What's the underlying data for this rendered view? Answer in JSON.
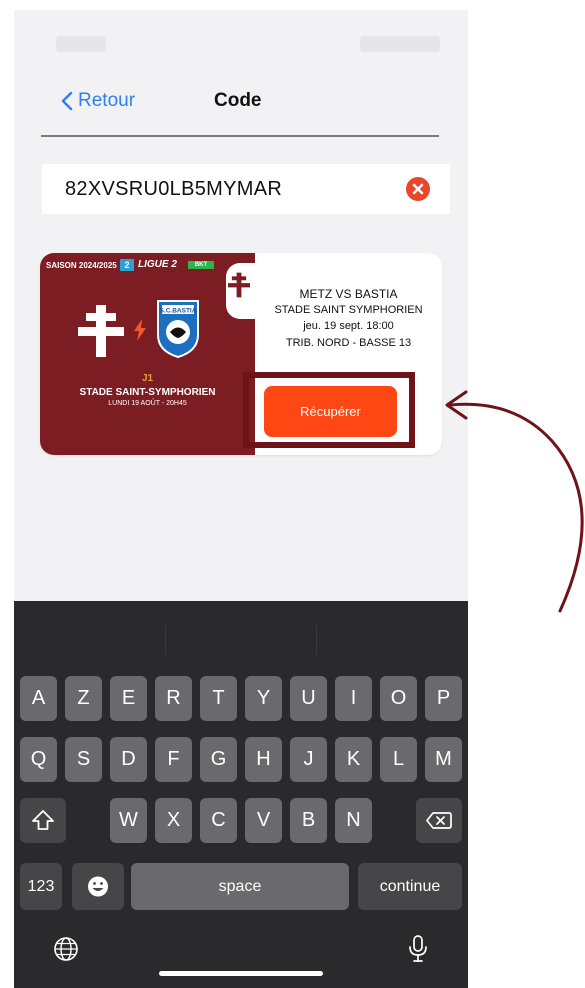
{
  "nav": {
    "back_label": "Retour",
    "title": "Code"
  },
  "code_input": {
    "value": "82XVSRU0LB5MYMAR"
  },
  "ticket": {
    "season": "SAISON 2024/2025",
    "league_badge": "2",
    "league": "LIGUE 2",
    "sponsor": "BKT",
    "away_crest_text": "S.C.BASTIA",
    "matchday": "J1",
    "stadium_left": "STADE SAINT-SYMPHORIEN",
    "date_left": "LUNDI 19 AOÛT - 20H45",
    "match": "METZ VS BASTIA",
    "venue": "STADE SAINT SYMPHORIEN",
    "datetime": "jeu. 19 sept. 18:00",
    "seat": "TRIB. NORD - BASSE  13",
    "action_label": "Récupérer"
  },
  "keyboard": {
    "row1": [
      "A",
      "Z",
      "E",
      "R",
      "T",
      "Y",
      "U",
      "I",
      "O",
      "P"
    ],
    "row2": [
      "Q",
      "S",
      "D",
      "F",
      "G",
      "H",
      "J",
      "K",
      "L",
      "M"
    ],
    "row3": [
      "W",
      "X",
      "C",
      "V",
      "B",
      "N"
    ],
    "numbers_label": "123",
    "space_label": "space",
    "return_label": "continue"
  },
  "colors": {
    "accent_blue": "#2f80ed",
    "action_orange": "#ff4713",
    "ticket_red": "#7b1d22",
    "highlight": "#6e1318",
    "clear_red": "#e8472b"
  }
}
